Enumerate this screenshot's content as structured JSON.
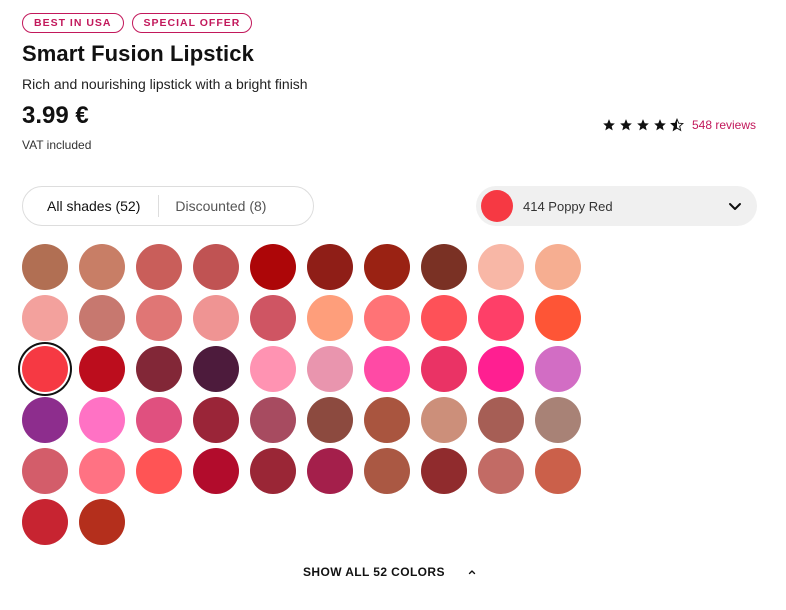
{
  "badges": [
    "BEST IN USA",
    "SPECIAL OFFER"
  ],
  "product": {
    "title": "Smart Fusion Lipstick",
    "subtitle": "Rich and nourishing lipstick with a bright finish",
    "price": "3.99 €",
    "vat": "VAT included"
  },
  "rating": {
    "stars": 4.5,
    "reviews": "548 reviews"
  },
  "tabs": {
    "all": "All shades (52)",
    "discounted": "Discounted (8)"
  },
  "shade_selector": {
    "label": "414 Poppy Red",
    "color": "#f63943",
    "icon": "chevron-down-icon"
  },
  "swatches": [
    "#b16f53",
    "#c87e66",
    "#c95e5a",
    "#c05353",
    "#ad0608",
    "#8f1e17",
    "#9a2213",
    "#7a3124",
    "#f8b7a6",
    "#f6ae91",
    "#f3a19d",
    "#c7786f",
    "#e07675",
    "#ef9493",
    "#cf5563",
    "#fe9e7b",
    "#ff7376",
    "#fe5158",
    "#fe3f68",
    "#fe5536",
    "#f63943",
    "#bc0d1d",
    "#822737",
    "#4d1b3c",
    "#ff93b2",
    "#e995ae",
    "#ff4aa5",
    "#ea3365",
    "#ff1f91",
    "#d26dc4",
    "#8d2d8d",
    "#ff72c4",
    "#e0507f",
    "#9a2538",
    "#a74b60",
    "#8c4a3f",
    "#a9553f",
    "#cc8f7a",
    "#a65e55",
    "#a88276",
    "#d35d6a",
    "#ff7283",
    "#ff5455",
    "#b20c2c",
    "#9a2636",
    "#a41f4b",
    "#aa5843",
    "#902b2d",
    "#c26b65",
    "#cb604a",
    "#c72431",
    "#b42f1c"
  ],
  "selected_swatch": "414 Poppy Red",
  "show_all": {
    "label": "SHOW ALL 52 COLORS",
    "icon": "chevron-up-icon"
  }
}
